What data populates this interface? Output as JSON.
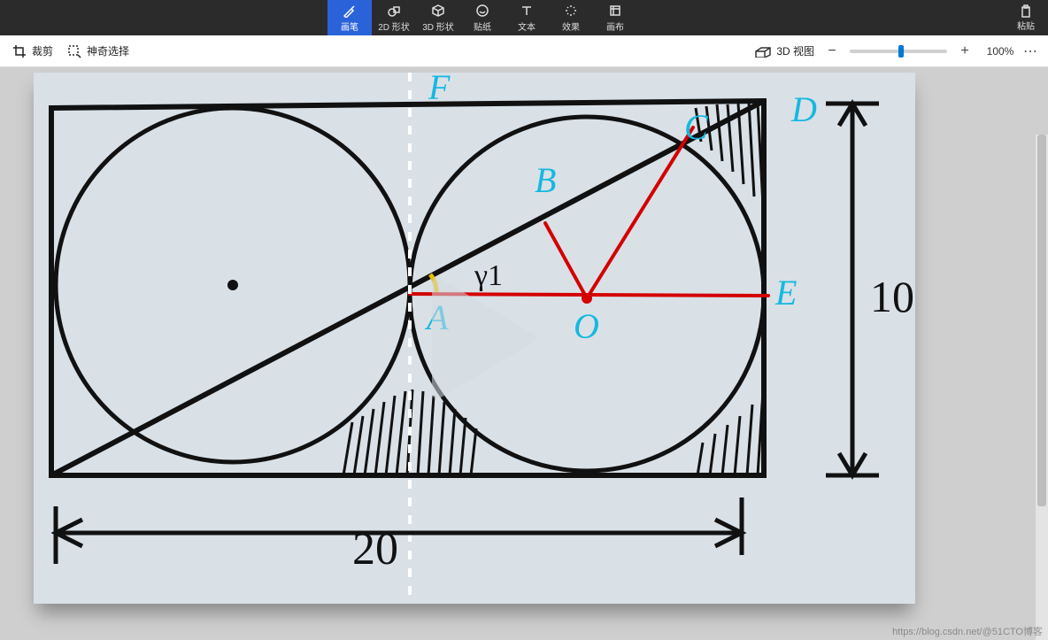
{
  "ribbon": {
    "tools": [
      {
        "id": "brush",
        "label": "画笔",
        "active": true
      },
      {
        "id": "shapes2d",
        "label": "2D 形状",
        "active": false
      },
      {
        "id": "shapes3d",
        "label": "3D 形状",
        "active": false
      },
      {
        "id": "stickers",
        "label": "贴纸",
        "active": false
      },
      {
        "id": "text",
        "label": "文本",
        "active": false
      },
      {
        "id": "effects",
        "label": "效果",
        "active": false
      },
      {
        "id": "canvas",
        "label": "画布",
        "active": false
      }
    ],
    "paste_label": "粘贴"
  },
  "subbar": {
    "crop_label": "裁剪",
    "magic_select_label": "神奇选择",
    "view3d_label": "3D 视图",
    "zoom_value": "100%"
  },
  "diagram": {
    "point_labels": {
      "A": "A",
      "B": "B",
      "C": "C",
      "D": "D",
      "E": "E",
      "F": "F",
      "O": "O"
    },
    "angle_label": "γ1",
    "width_dim": "20",
    "height_dim": "10"
  },
  "watermark": "https://blog.csdn.net/@51CTO博客"
}
